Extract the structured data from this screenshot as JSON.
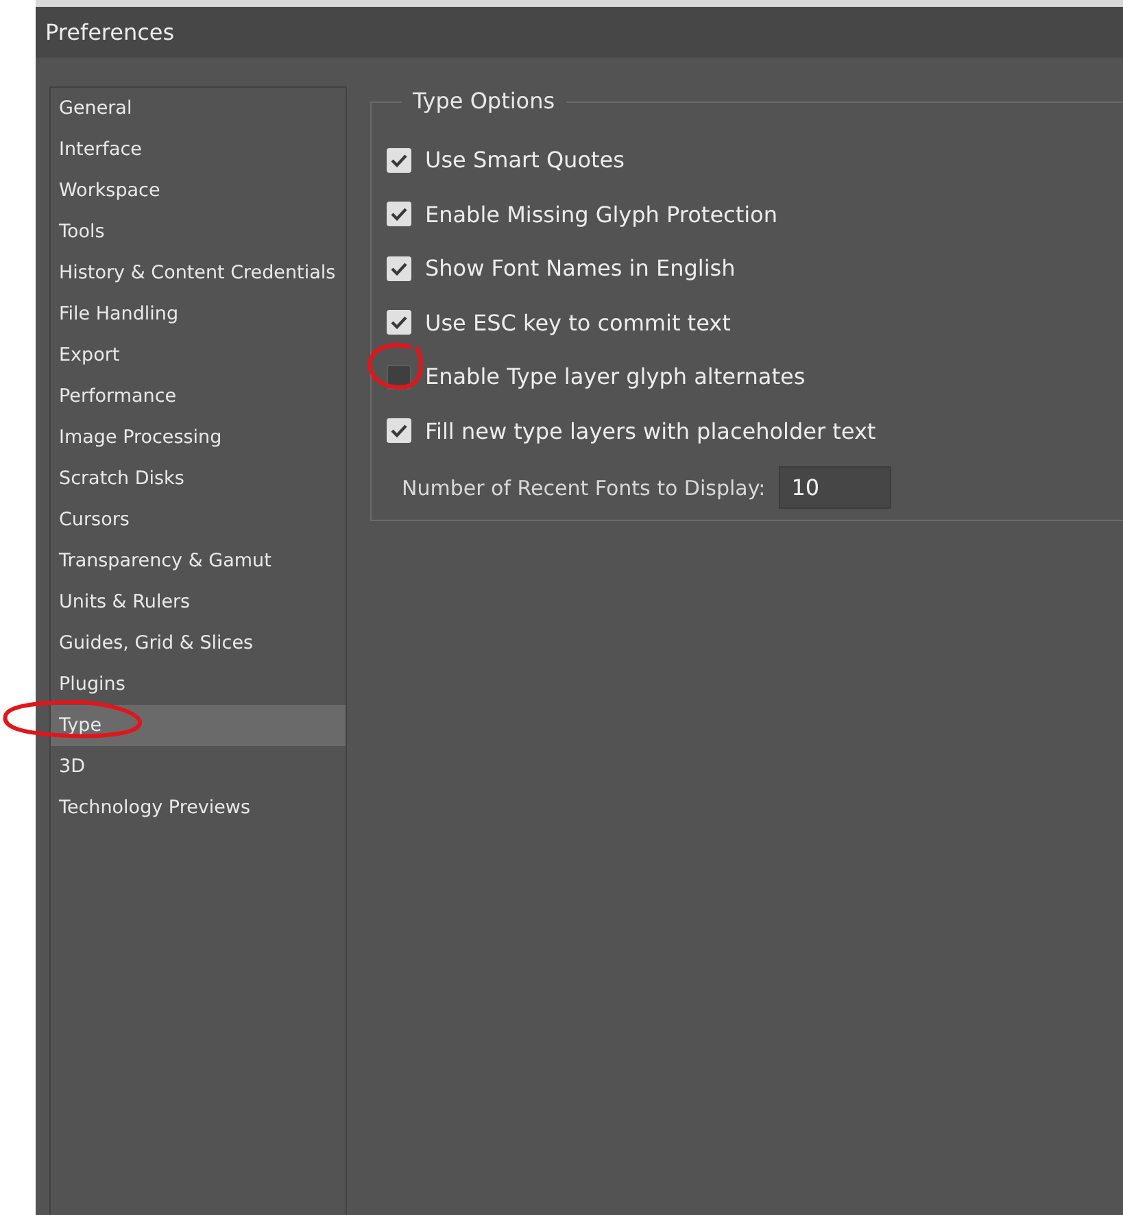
{
  "window": {
    "title": "Preferences"
  },
  "sidebar": {
    "items": [
      {
        "label": "General",
        "selected": false
      },
      {
        "label": "Interface",
        "selected": false
      },
      {
        "label": "Workspace",
        "selected": false
      },
      {
        "label": "Tools",
        "selected": false
      },
      {
        "label": "History & Content Credentials",
        "selected": false
      },
      {
        "label": "File Handling",
        "selected": false
      },
      {
        "label": "Export",
        "selected": false
      },
      {
        "label": "Performance",
        "selected": false
      },
      {
        "label": "Image Processing",
        "selected": false
      },
      {
        "label": "Scratch Disks",
        "selected": false
      },
      {
        "label": "Cursors",
        "selected": false
      },
      {
        "label": "Transparency & Gamut",
        "selected": false
      },
      {
        "label": "Units & Rulers",
        "selected": false
      },
      {
        "label": "Guides, Grid & Slices",
        "selected": false
      },
      {
        "label": "Plugins",
        "selected": false
      },
      {
        "label": "Type",
        "selected": true
      },
      {
        "label": "3D",
        "selected": false
      },
      {
        "label": "Technology Previews",
        "selected": false
      }
    ]
  },
  "type_options": {
    "title": "Type Options",
    "checkboxes": [
      {
        "label": "Use Smart Quotes",
        "checked": true
      },
      {
        "label": "Enable Missing Glyph Protection",
        "checked": true
      },
      {
        "label": "Show Font Names in English",
        "checked": true
      },
      {
        "label": "Use ESC key to commit text",
        "checked": true
      },
      {
        "label": "Enable Type layer glyph alternates",
        "checked": false
      },
      {
        "label": "Fill new type layers with placeholder text",
        "checked": true
      }
    ],
    "recent_fonts": {
      "label": "Number of Recent Fonts to Display:",
      "value": "10"
    }
  }
}
